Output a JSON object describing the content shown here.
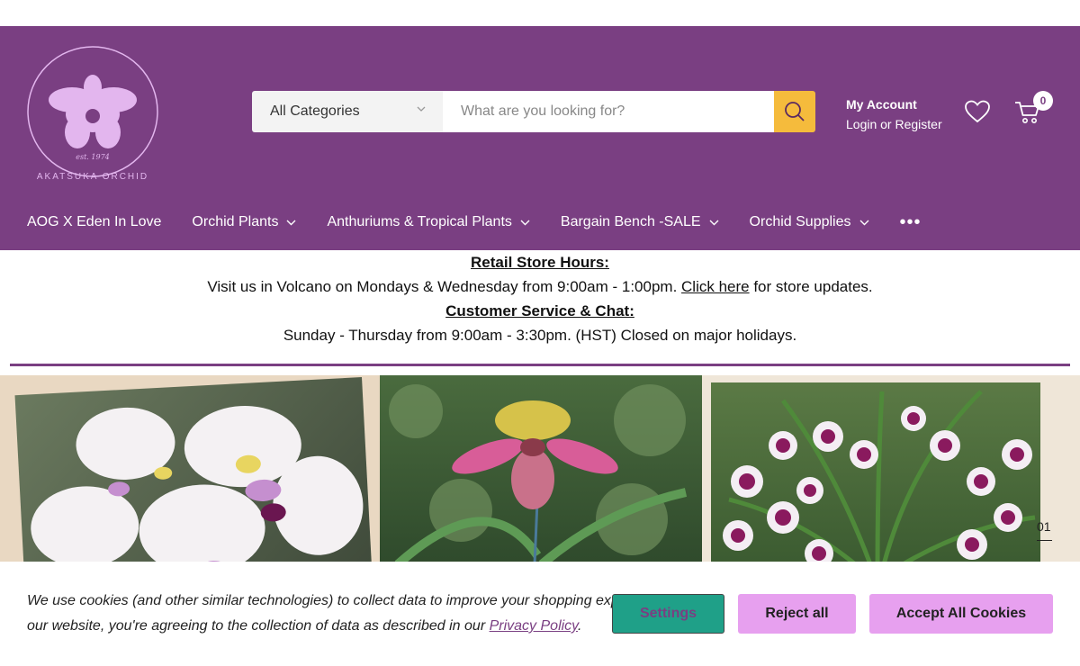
{
  "brand": {
    "name": "AKATSUKA ORCHID",
    "est": "est. 1974"
  },
  "search": {
    "category_selected": "All Categories",
    "placeholder": "What are you looking for?",
    "value": ""
  },
  "account": {
    "title": "My Account",
    "subtitle": "Login or Register"
  },
  "cart": {
    "count": "0"
  },
  "nav": {
    "items": [
      {
        "label": "AOG X Eden In Love"
      },
      {
        "label": "Orchid Plants"
      },
      {
        "label": "Anthuriums & Tropical Plants"
      },
      {
        "label": "Bargain Bench -SALE"
      },
      {
        "label": "Orchid Supplies"
      }
    ],
    "more": "•••"
  },
  "notice": {
    "store_heading": "Retail Store Hours:",
    "store_pre": "Visit us in Volcano on Mondays & Wednesday from 9:00am - 1:00pm. ",
    "store_link": "Click here",
    "store_post": " for store updates.",
    "service_heading": "Customer Service & Chat:",
    "service_text": "Sunday - Thursday from 9:00am - 3:30pm. (HST)  Closed on major holidays."
  },
  "hero": {
    "slide_number": "01"
  },
  "cookie": {
    "line1": "We use cookies (and other similar technologies) to collect data to improve your shopping exp",
    "line2_pre": "our website, you're agreeing to the collection of data as described in our ",
    "policy_link": "Privacy Policy",
    "line2_post": ".",
    "settings_label": "Settings",
    "reject_label": "Reject all",
    "accept_label": "Accept All Cookies"
  },
  "colors": {
    "header_bg": "#7a3f82",
    "search_button": "#f5bb3c",
    "teal": "#1fa088",
    "pink_button": "#e7a0ef"
  }
}
